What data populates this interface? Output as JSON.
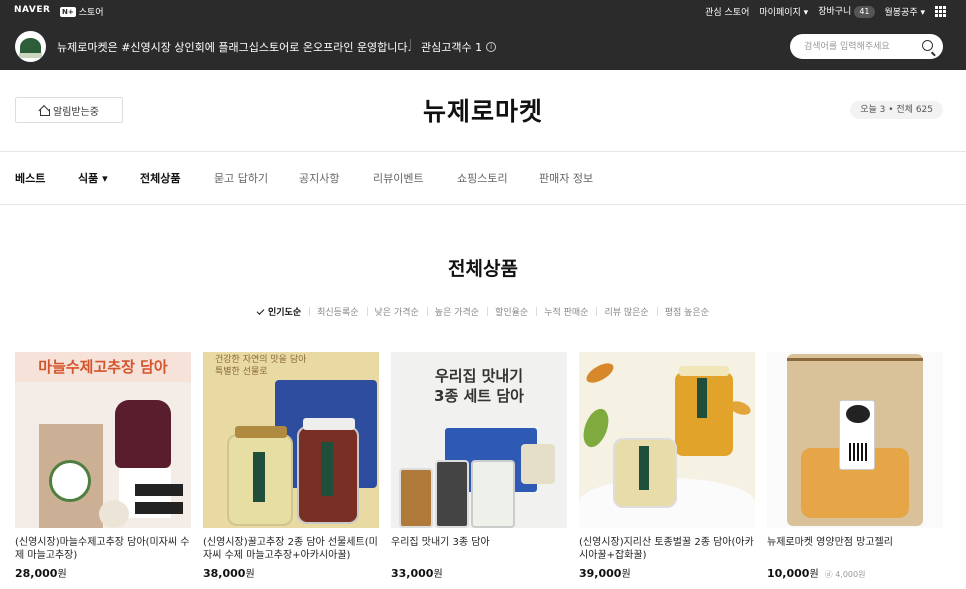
{
  "topbar": {
    "naver": "NAVER",
    "np_badge": "N+",
    "np_label": "스토어",
    "links": [
      "관심 스토어",
      "마이페이지 ▾",
      "장바구니",
      "월봉공주 ▾"
    ],
    "cart_count": "41"
  },
  "store": {
    "description": "뉴제로마켓은 #신영시장 상인회에 플래그십스토어로 온오프라인 운영합니다.",
    "interest_label": "관심고객수 1",
    "search_placeholder": "검색어를 입력해주세요"
  },
  "brand": {
    "alarm_label": "알림받는중",
    "name": "뉴제로마켓",
    "visits": "오늘 3 • 전체 625"
  },
  "nav": {
    "items": [
      "베스트",
      "식품 ▾",
      "전체상품",
      "묻고 답하기",
      "공지사항",
      "리뷰이벤트",
      "쇼핑스토리",
      "판매자 정보"
    ]
  },
  "section": {
    "title": "전체상품",
    "sort_options": [
      "인기도순",
      "최신등록순",
      "낮은 가격순",
      "높은 가격순",
      "할인율순",
      "누적 판매순",
      "리뷰 많은순",
      "평점 높은순"
    ]
  },
  "thumb_text": {
    "p1_banner": "마늘수제고추장 담아",
    "p2_caption_1": "건강한 자연의 맛을 담아",
    "p2_caption_2": "특별한 선물로",
    "p3_headline_1": "우리집 맛내기",
    "p3_headline_2": "3종 세트 담아"
  },
  "products": [
    {
      "name": "(신영시장)마늘수제고추장 담아(미자씨 수제 마늘고추장)",
      "price": "28,000",
      "unit": "원"
    },
    {
      "name": "(신영시장)꿀고추장 2종 담아 선물세트(미자씨 수제 마늘고추장+아카시아꿀)",
      "price": "38,000",
      "unit": "원"
    },
    {
      "name": "우리집 맛내기 3종 담아",
      "price": "33,000",
      "unit": "원"
    },
    {
      "name": "(신영시장)지리산 토종벌꿀 2종 담아(아카시아꿀+잡화꿀)",
      "price": "39,000",
      "unit": "원"
    },
    {
      "name": "뉴제로마켓 영양만점 망고젤리",
      "price": "10,000",
      "unit": "원",
      "extra": "ⓓ 4,000원"
    }
  ],
  "colors": {
    "topbar_bg": "#2b2b2b",
    "accent": "#d4542b"
  }
}
